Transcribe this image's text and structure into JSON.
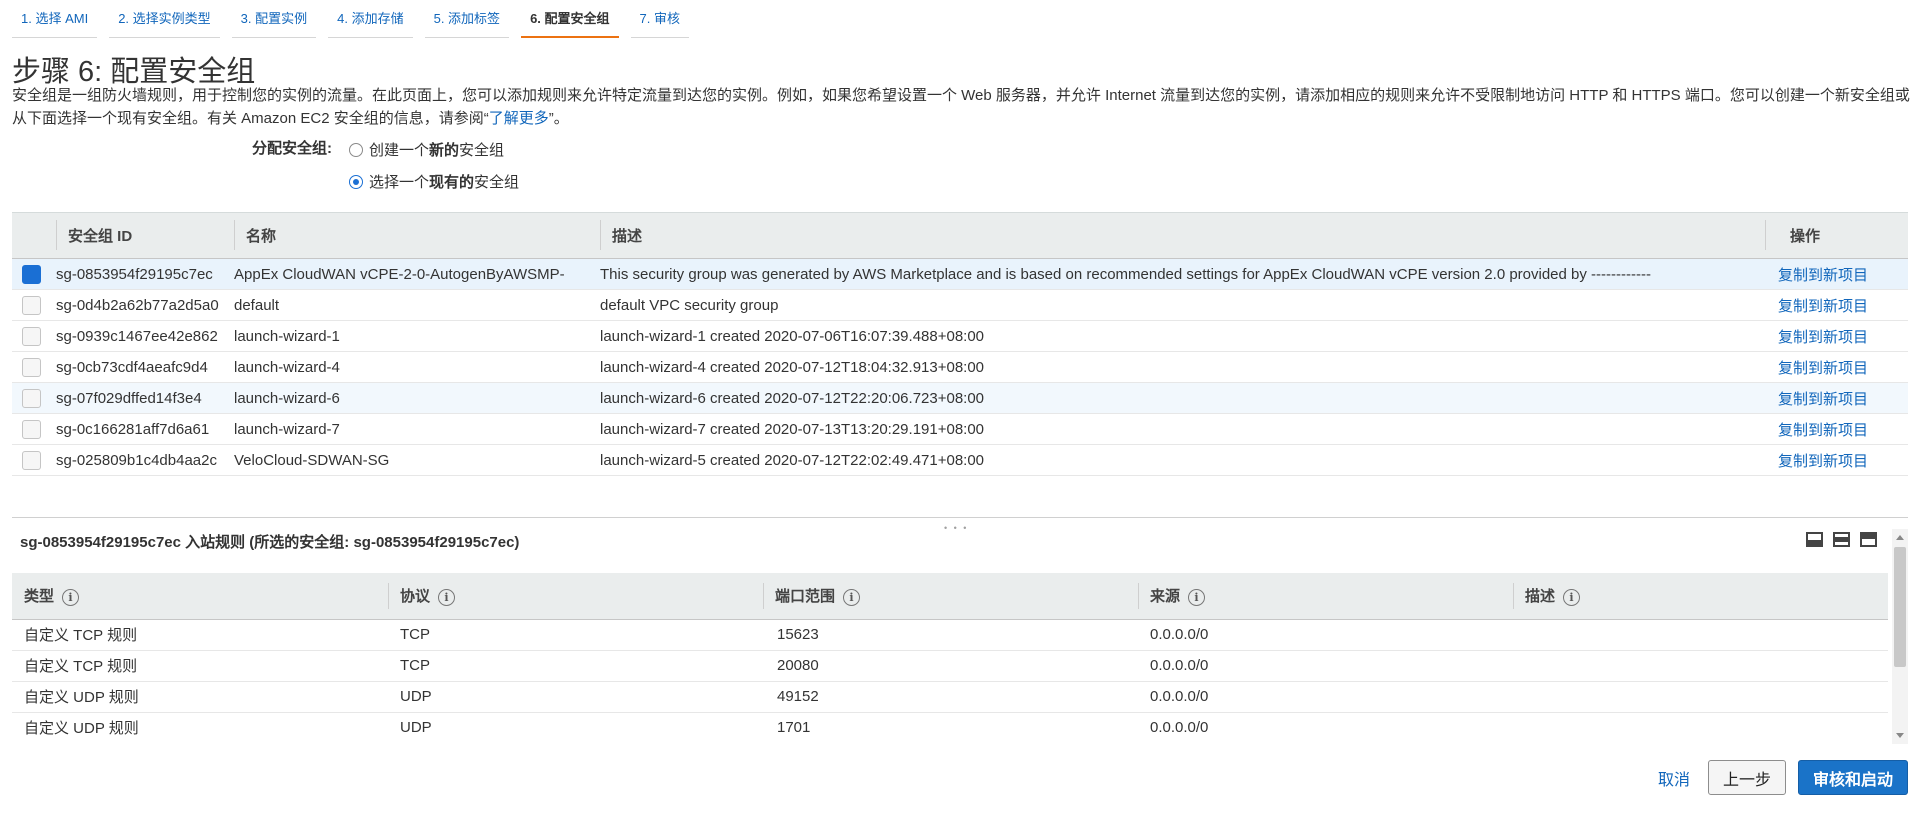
{
  "steps": [
    {
      "label": "1. 选择 AMI",
      "active": false
    },
    {
      "label": "2. 选择实例类型",
      "active": false
    },
    {
      "label": "3. 配置实例",
      "active": false
    },
    {
      "label": "4. 添加存储",
      "active": false
    },
    {
      "label": "5. 添加标签",
      "active": false
    },
    {
      "label": "6. 配置安全组",
      "active": true
    },
    {
      "label": "7. 审核",
      "active": false
    }
  ],
  "header": {
    "title": "步骤 6: 配置安全组",
    "description": "安全组是一组防火墙规则，用于控制您的实例的流量。在此页面上，您可以添加规则来允许特定流量到达您的实例。例如，如果您希望设置一个 Web 服务器，并允许 Internet 流量到达您的实例，请添加相应的规则来允许不受限制地访问 HTTP 和 HTTPS 端口。您可以创建一个新安全组或从下面选择一个现有安全组。有关 Amazon EC2 安全组的信息，请参阅“",
    "learn_more": "了解更多",
    "description_end": "”。"
  },
  "assign": {
    "label": "分配安全组:",
    "option_new_pre": "创建一个",
    "option_new_bold": "新的",
    "option_new_post": "安全组",
    "option_existing_pre": "选择一个",
    "option_existing_bold": "现有的",
    "option_existing_post": "安全组",
    "selected": "existing"
  },
  "sg_table": {
    "headers": {
      "id": "安全组 ID",
      "name": "名称",
      "desc": "描述",
      "op": "操作"
    },
    "rows": [
      {
        "id": "sg-0853954f29195c7ec",
        "name": "AppEx CloudWAN vCPE-2-0-AutogenByAWSMP-",
        "desc": "This security group was generated by AWS Marketplace and is based on recommended settings for AppEx CloudWAN vCPE version 2.0 provided by ------------",
        "op": "复制到新项目",
        "checked": true
      },
      {
        "id": "sg-0d4b2a62b77a2d5a0",
        "name": "default",
        "desc": "default VPC security group",
        "op": "复制到新项目",
        "checked": false
      },
      {
        "id": "sg-0939c1467ee42e862",
        "name": "launch-wizard-1",
        "desc": "launch-wizard-1 created 2020-07-06T16:07:39.488+08:00",
        "op": "复制到新项目",
        "checked": false
      },
      {
        "id": "sg-0cb73cdf4aeafc9d4",
        "name": "launch-wizard-4",
        "desc": "launch-wizard-4 created 2020-07-12T18:04:32.913+08:00",
        "op": "复制到新项目",
        "checked": false
      },
      {
        "id": "sg-07f029dffed14f3e4",
        "name": "launch-wizard-6",
        "desc": "launch-wizard-6 created 2020-07-12T22:20:06.723+08:00",
        "op": "复制到新项目",
        "checked": false
      },
      {
        "id": "sg-0c166281aff7d6a61",
        "name": "launch-wizard-7",
        "desc": "launch-wizard-7 created 2020-07-13T13:20:29.191+08:00",
        "op": "复制到新项目",
        "checked": false
      },
      {
        "id": "sg-025809b1c4db4aa2c",
        "name": "VeloCloud-SDWAN-SG",
        "desc": "launch-wizard-5 created 2020-07-12T22:02:49.471+08:00",
        "op": "复制到新项目",
        "checked": false
      }
    ]
  },
  "inbound": {
    "title": "sg-0853954f29195c7ec 入站规则 (所选的安全组: sg-0853954f29195c7ec)",
    "headers": {
      "type": "类型",
      "protocol": "协议",
      "port": "端口范围",
      "source": "来源",
      "desc": "描述"
    },
    "rows": [
      {
        "type": "自定义 TCP 规则",
        "protocol": "TCP",
        "port": "15623",
        "source": "0.0.0.0/0",
        "desc": ""
      },
      {
        "type": "自定义 TCP 规则",
        "protocol": "TCP",
        "port": "20080",
        "source": "0.0.0.0/0",
        "desc": ""
      },
      {
        "type": "自定义 UDP 规则",
        "protocol": "UDP",
        "port": "49152",
        "source": "0.0.0.0/0",
        "desc": ""
      },
      {
        "type": "自定义 UDP 规则",
        "protocol": "UDP",
        "port": "1701",
        "source": "0.0.0.0/0",
        "desc": ""
      }
    ]
  },
  "footer": {
    "cancel": "取消",
    "previous": "上一步",
    "review": "审核和启动"
  }
}
